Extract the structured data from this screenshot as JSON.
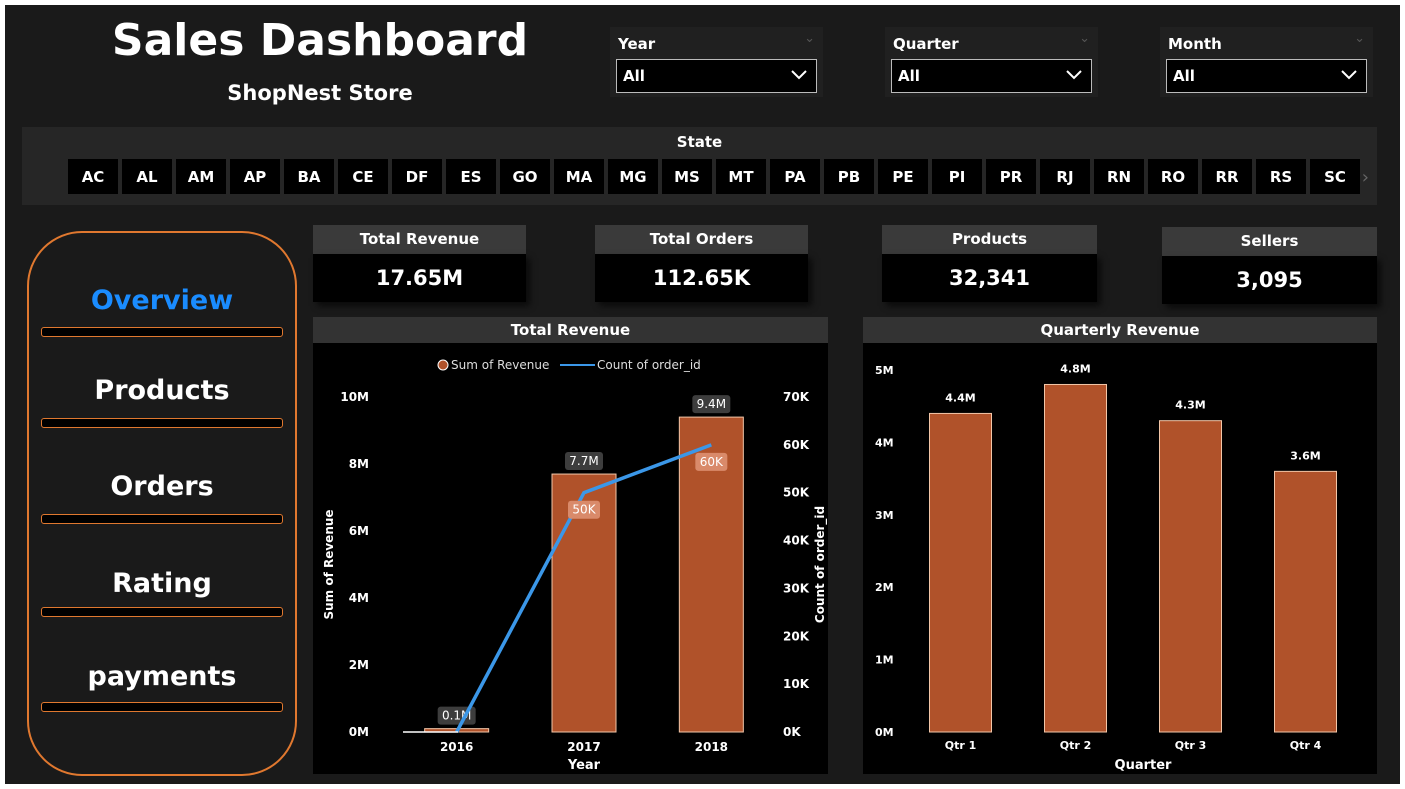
{
  "header": {
    "title": "Sales Dashboard",
    "subtitle": "ShopNest Store"
  },
  "filters": [
    {
      "label": "Year",
      "value": "All"
    },
    {
      "label": "Quarter",
      "value": "All"
    },
    {
      "label": "Month",
      "value": "All"
    }
  ],
  "state_filter": {
    "title": "State",
    "states": [
      "AC",
      "AL",
      "AM",
      "AP",
      "BA",
      "CE",
      "DF",
      "ES",
      "GO",
      "MA",
      "MG",
      "MS",
      "MT",
      "PA",
      "PB",
      "PE",
      "PI",
      "PR",
      "RJ",
      "RN",
      "RO",
      "RR",
      "RS",
      "SC"
    ]
  },
  "nav": {
    "items": [
      {
        "label": "Overview",
        "active": true
      },
      {
        "label": "Products",
        "active": false
      },
      {
        "label": "Orders",
        "active": false
      },
      {
        "label": "Rating",
        "active": false
      },
      {
        "label": "payments",
        "active": false
      }
    ]
  },
  "kpis": [
    {
      "label": "Total Revenue",
      "value": "17.65M"
    },
    {
      "label": "Total Orders",
      "value": "112.65K"
    },
    {
      "label": "Products",
      "value": "32,341"
    },
    {
      "label": "Sellers",
      "value": "3,095"
    }
  ],
  "colors": {
    "bar": "#b0522a",
    "line": "#3b97e8",
    "accent_orange": "#e0782f",
    "active_nav": "#1a8cff"
  },
  "chart_data": [
    {
      "type": "bar",
      "title": "Total Revenue",
      "categories": [
        "2016",
        "2017",
        "2018"
      ],
      "series": [
        {
          "name": "Sum of Revenue",
          "type": "bar",
          "values": [
            0.1,
            7.7,
            9.4
          ],
          "labels": [
            "0.1M",
            "7.7M",
            "9.4M"
          ]
        },
        {
          "name": "Count of order_id",
          "type": "line",
          "values": [
            0,
            50,
            60
          ],
          "labels": [
            "",
            "50K",
            "60K"
          ]
        }
      ],
      "xlabel": "Year",
      "ylabel": "Sum of Revenue",
      "y2label": "Count of order_id",
      "ylim": [
        0,
        10
      ],
      "yticks": [
        "0M",
        "2M",
        "4M",
        "6M",
        "8M",
        "10M"
      ],
      "y2lim": [
        0,
        70
      ],
      "y2ticks": [
        "0K",
        "10K",
        "20K",
        "30K",
        "40K",
        "50K",
        "60K",
        "70K"
      ],
      "legend": "top"
    },
    {
      "type": "bar",
      "title": "Quarterly Revenue",
      "categories": [
        "Qtr 1",
        "Qtr 2",
        "Qtr 3",
        "Qtr 4"
      ],
      "values": [
        4.4,
        4.8,
        4.3,
        3.6
      ],
      "labels": [
        "4.4M",
        "4.8M",
        "4.3M",
        "3.6M"
      ],
      "xlabel": "Quarter",
      "ylabel": "",
      "ylim": [
        0,
        5
      ],
      "yticks": [
        "0M",
        "1M",
        "2M",
        "3M",
        "4M",
        "5M"
      ]
    }
  ]
}
